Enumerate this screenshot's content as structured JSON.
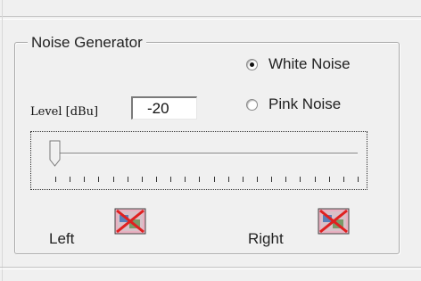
{
  "group": {
    "legend": "Noise Generator"
  },
  "noise_type": {
    "options": [
      {
        "label": "White Noise",
        "selected": true
      },
      {
        "label": "Pink Noise",
        "selected": false
      }
    ]
  },
  "level": {
    "label": "Level [dBu]",
    "value": "-20"
  },
  "slider": {
    "position_fraction": 0.0,
    "tick_count": 22
  },
  "channels": {
    "left_label": "Left",
    "right_label": "Right",
    "left_icon": "broken-image-icon",
    "right_icon": "broken-image-icon"
  },
  "colors": {
    "broken_image_red": "#e02020",
    "broken_image_pink": "#e8b0c0"
  }
}
